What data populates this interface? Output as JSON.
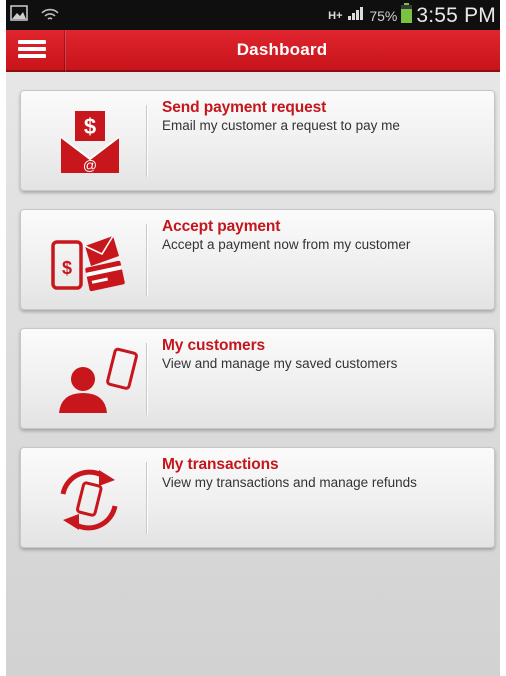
{
  "status_bar": {
    "network": "H+",
    "battery_percent": "75%",
    "time": "3:55 PM"
  },
  "header": {
    "title": "Dashboard"
  },
  "colors": {
    "brand_red": "#c4161c",
    "header_red": "#d71f26",
    "text_dark": "#333333"
  },
  "cards": [
    {
      "title": "Send payment request",
      "description": "Email my customer a request to pay me",
      "icon": "envelope-dollar-icon"
    },
    {
      "title": "Accept payment",
      "description": "Accept a payment now from my customer",
      "icon": "phone-card-icon"
    },
    {
      "title": "My customers",
      "description": "View and manage my saved customers",
      "icon": "person-phone-icon"
    },
    {
      "title": "My transactions",
      "description": "View my transactions and manage refunds",
      "icon": "refresh-phone-icon"
    }
  ]
}
